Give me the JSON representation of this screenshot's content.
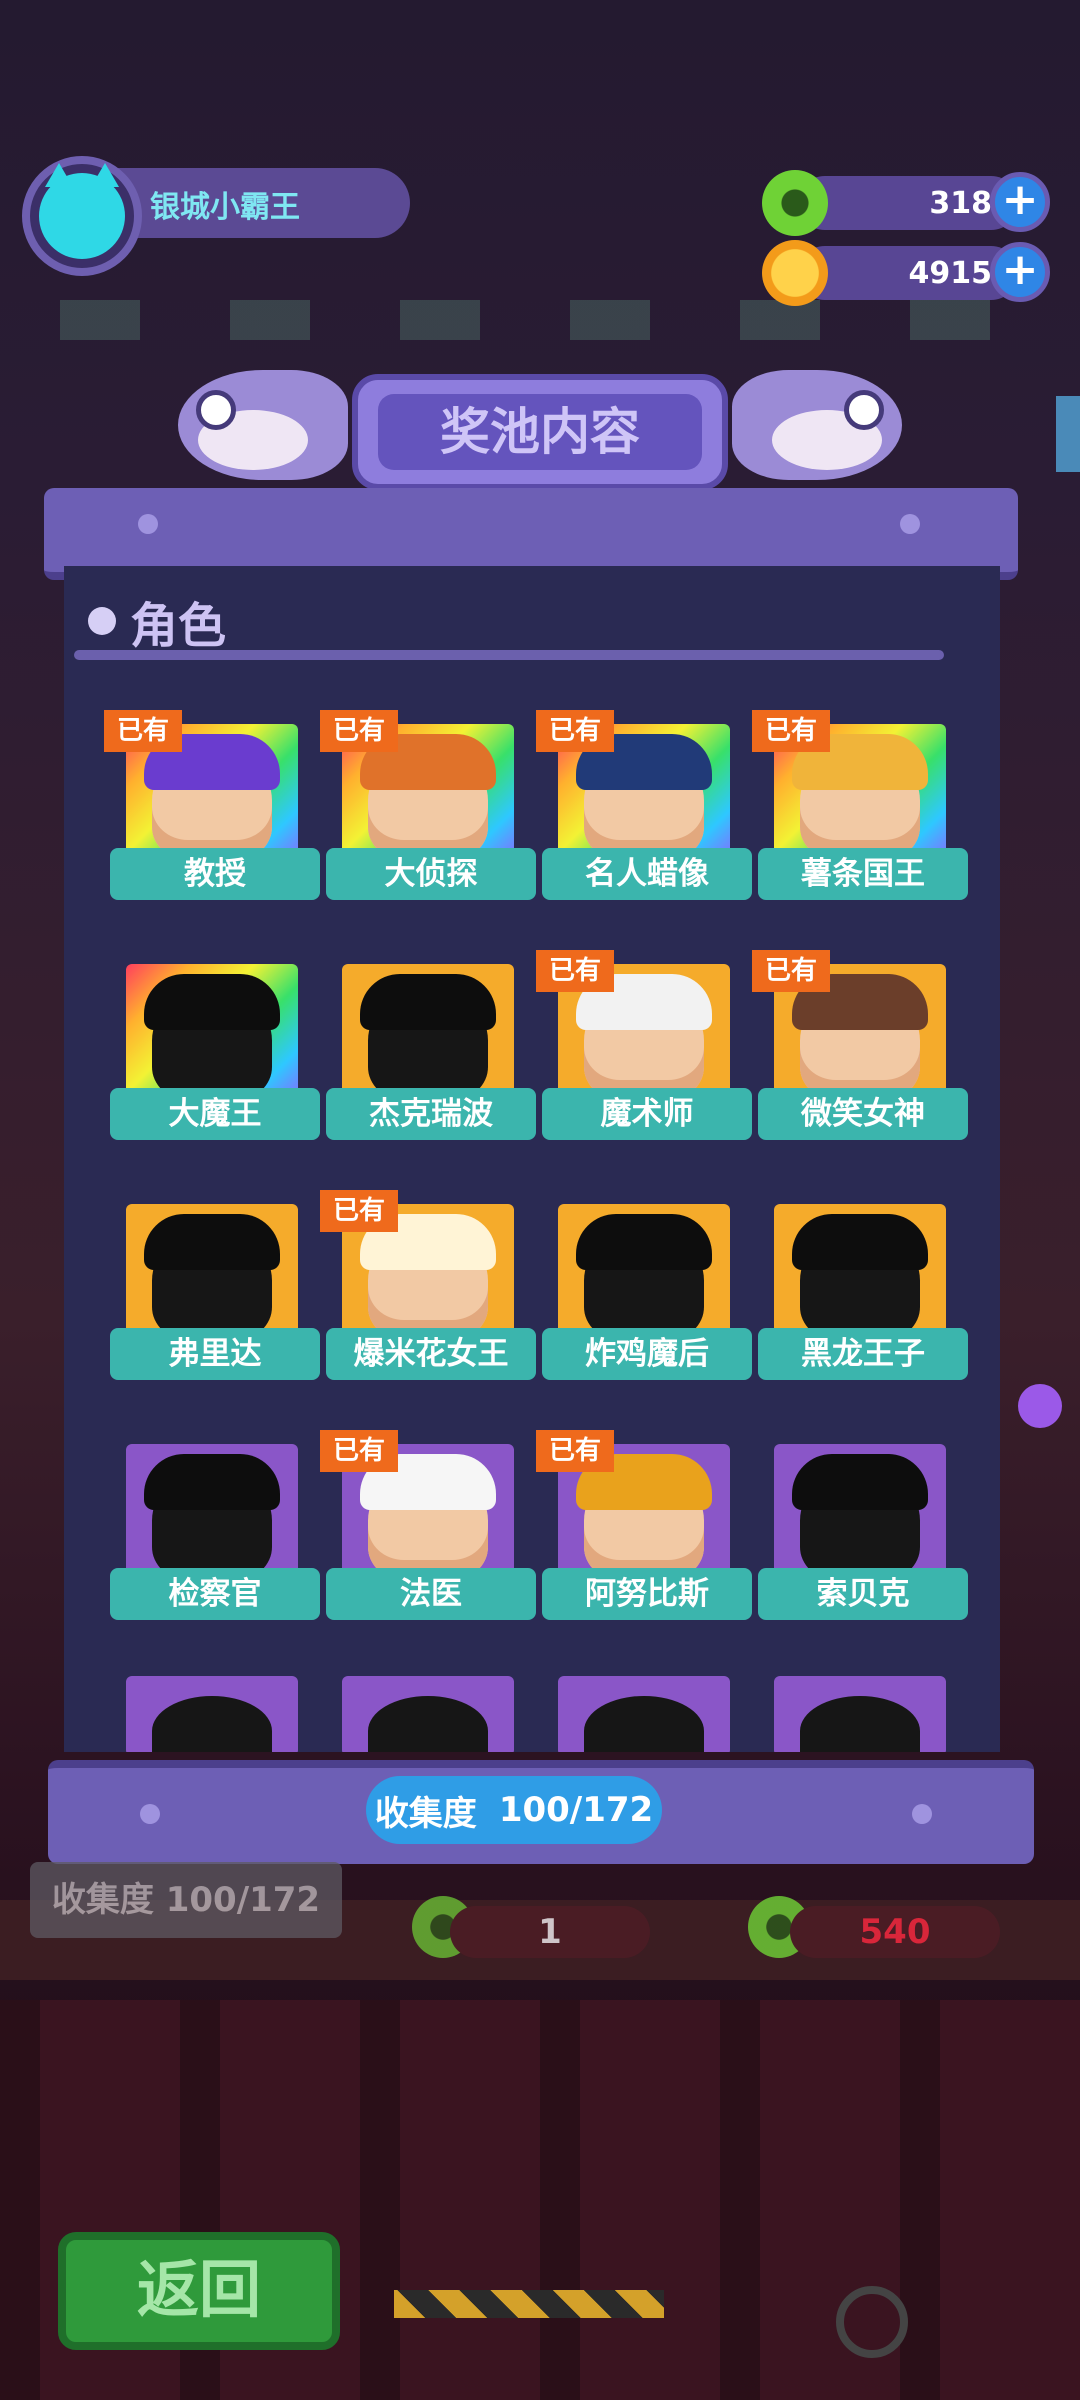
{
  "header": {
    "player_name": "银城小霸王",
    "currencies": [
      {
        "icon": "green-donut-coin-icon",
        "value": "318"
      },
      {
        "icon": "gold-planet-coin-icon",
        "value": "4915"
      }
    ]
  },
  "panel": {
    "title": "奖池内容",
    "section_title": "角色",
    "owned_badge": "已有",
    "characters": [
      {
        "name": "教授",
        "owned": true,
        "frame": "rainbow"
      },
      {
        "name": "大侦探",
        "owned": true,
        "frame": "rainbow"
      },
      {
        "name": "名人蜡像",
        "owned": true,
        "frame": "rainbow"
      },
      {
        "name": "薯条国王",
        "owned": true,
        "frame": "rainbow"
      },
      {
        "name": "大魔王",
        "owned": false,
        "frame": "rainbow"
      },
      {
        "name": "杰克瑞波",
        "owned": false,
        "frame": "gold"
      },
      {
        "name": "魔术师",
        "owned": true,
        "frame": "gold"
      },
      {
        "name": "微笑女神",
        "owned": true,
        "frame": "gold"
      },
      {
        "name": "弗里达",
        "owned": false,
        "frame": "gold"
      },
      {
        "name": "爆米花女王",
        "owned": true,
        "frame": "gold"
      },
      {
        "name": "炸鸡魔后",
        "owned": false,
        "frame": "gold"
      },
      {
        "name": "黑龙王子",
        "owned": false,
        "frame": "gold"
      },
      {
        "name": "检察官",
        "owned": false,
        "frame": "purple"
      },
      {
        "name": "法医",
        "owned": true,
        "frame": "purple"
      },
      {
        "name": "阿努比斯",
        "owned": true,
        "frame": "purple"
      },
      {
        "name": "索贝克",
        "owned": false,
        "frame": "purple"
      }
    ],
    "collection_label": "收集度",
    "collection_value": "100/172"
  },
  "background": {
    "collection_text": "收集度  100/172",
    "ticket_count": "1",
    "price": "540",
    "back_button": "返回"
  },
  "colors": {
    "owned_badge": "#ef6a1c",
    "name_plate": "#3bb5ad",
    "panel_bg": "#2a2a53",
    "collection_pill": "#2f9de6"
  }
}
